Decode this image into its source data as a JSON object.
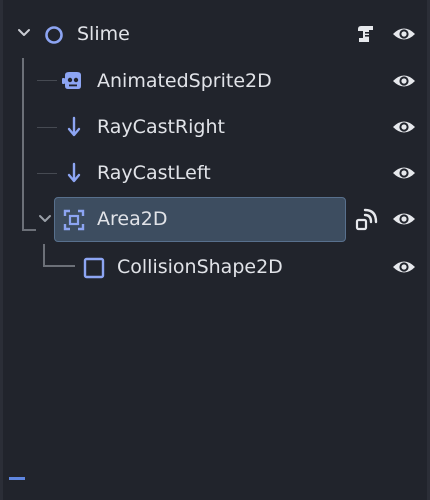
{
  "scene_tree": {
    "nodes": [
      {
        "label": "Slime",
        "icon": "node2d-circle-icon",
        "has_script": true,
        "visible": true,
        "expanded": true
      },
      {
        "label": "AnimatedSprite2D",
        "icon": "animated-sprite-icon",
        "visible": true
      },
      {
        "label": "RayCastRight",
        "icon": "raycast-arrow-icon",
        "visible": true
      },
      {
        "label": "RayCastLeft",
        "icon": "raycast-arrow-icon",
        "visible": true
      },
      {
        "label": "Area2D",
        "icon": "area2d-icon",
        "has_signals": true,
        "visible": true,
        "expanded": true,
        "selected": true
      },
      {
        "label": "CollisionShape2D",
        "icon": "collision-shape-icon",
        "visible": true
      }
    ]
  },
  "colors": {
    "background": "#21242c",
    "selected_row": "#3d4d60",
    "node_icon": "#8da5f3",
    "text": "#e1e3e8",
    "guide_line": "#6c7078"
  }
}
